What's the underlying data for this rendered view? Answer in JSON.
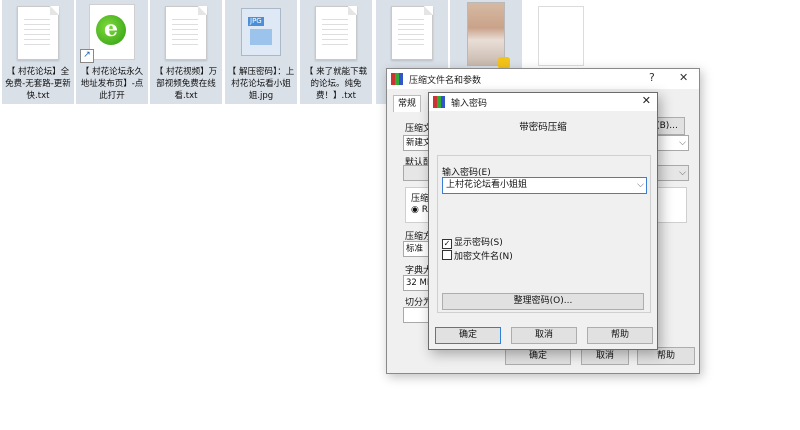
{
  "desktop": {
    "files": [
      {
        "caption": "【 村花论坛】全免费-无套路-更新快.txt",
        "icon": "text-file-icon"
      },
      {
        "caption": "【 村花论坛永久地址发布页】-点此打开",
        "icon": "ie-shortcut-icon"
      },
      {
        "caption": "【 村花视频】万部视频免费在线看.txt",
        "icon": "text-file-icon"
      },
      {
        "caption": "【 解压密码】：上村花论坛看小姐姐.jpg",
        "icon": "jpg-file-icon"
      },
      {
        "caption": "【 来了就能下载的论坛。纯免费！】.txt",
        "icon": "text-file-icon"
      },
      {
        "caption": "",
        "icon": "text-file-icon"
      },
      {
        "caption": "",
        "icon": "photo-thumbnail-icon"
      },
      {
        "caption": "",
        "icon": "blank-file-icon"
      }
    ]
  },
  "outer_dialog": {
    "title": "压缩文件名和参数",
    "help_glyph": "?",
    "close_glyph": "✕",
    "tab_general": "常规",
    "label_archive_name": "压缩文",
    "archive_name_value": "新建文",
    "browse_button": "(B)...",
    "label_default_profile": "默认配",
    "label_format": "压缩",
    "format_option": "RA",
    "label_method": "压缩方",
    "method_value": "标准",
    "label_dict": "字典大",
    "dict_value": "32 MB",
    "label_split": "切分为",
    "ok": "确定",
    "cancel": "取消",
    "help": "帮助"
  },
  "inner_dialog": {
    "title": "输入密码",
    "close_glyph": "✕",
    "heading": "带密码压缩",
    "label_password": "输入密码(E)",
    "password_value": "上村花论坛看小姐姐",
    "show_password_label": "显示密码(S)",
    "show_password_checked": true,
    "encrypt_names_label": "加密文件名(N)",
    "encrypt_names_checked": false,
    "organize_button": "整理密码(O)...",
    "ok": "确定",
    "cancel": "取消",
    "help": "帮助",
    "checkmark": "✓",
    "dropdown_glyph": "⌵"
  }
}
